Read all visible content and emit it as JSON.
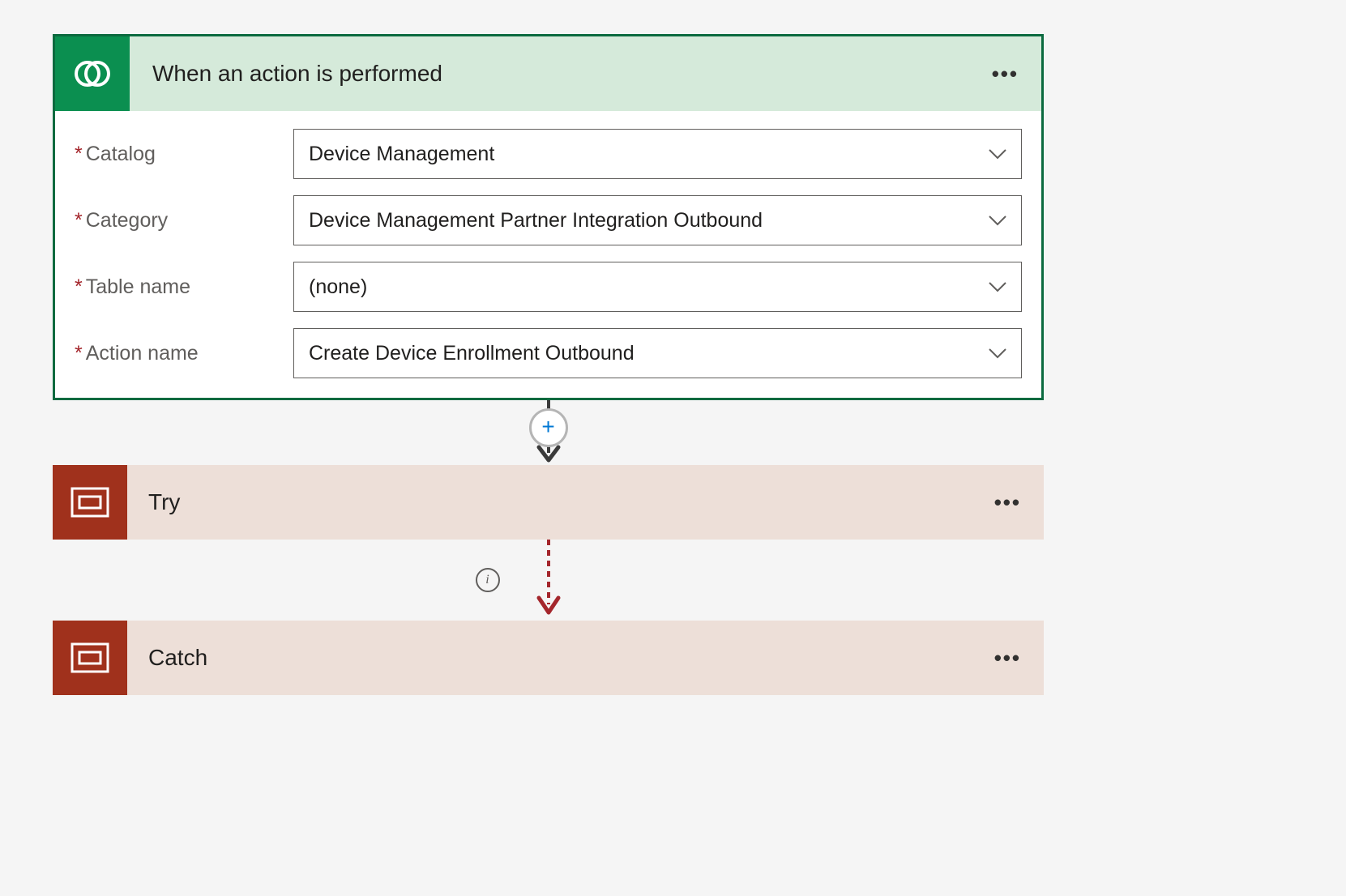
{
  "trigger": {
    "title": "When an action is performed",
    "fields": {
      "catalog": {
        "label": "Catalog",
        "value": "Device Management"
      },
      "category": {
        "label": "Category",
        "value": "Device Management Partner Integration Outbound"
      },
      "table_name": {
        "label": "Table name",
        "value": "(none)"
      },
      "action_name": {
        "label": "Action name",
        "value": "Create Device Enrollment Outbound"
      }
    }
  },
  "scopes": {
    "try": {
      "label": "Try"
    },
    "catch": {
      "label": "Catch"
    }
  },
  "icons": {
    "more": "•••",
    "info": "i"
  },
  "colors": {
    "trigger_accent": "#0b8f50",
    "trigger_border": "#0b6a3f",
    "trigger_header_bg": "#d5eada",
    "scope_accent": "#a0311c",
    "scope_bg": "#eddfd8",
    "error_arrow": "#a4262c"
  }
}
